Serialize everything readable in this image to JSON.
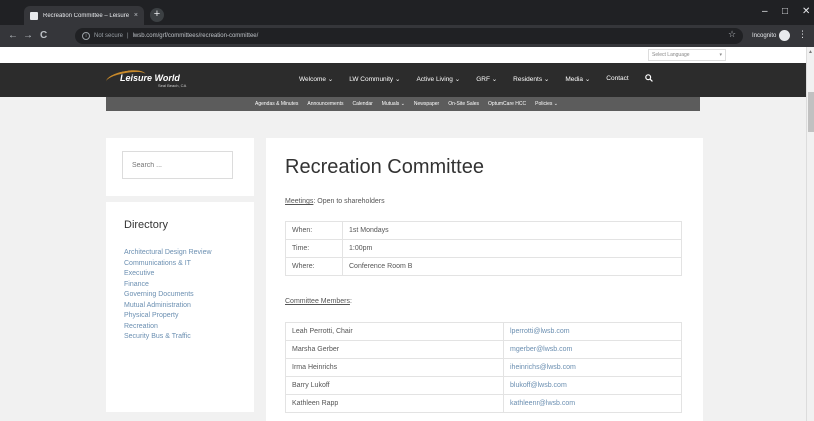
{
  "browser": {
    "tab_title": "Recreation Committee – Leisure",
    "tab_close": "×",
    "new_tab": "+",
    "window_controls": {
      "minimize": "–",
      "maximize": "□",
      "close": "✕"
    },
    "nav": {
      "back": "←",
      "forward": "→",
      "reload": "C"
    },
    "security_label": "Not secure",
    "separator": "|",
    "url": "lwsb.com/grf/committees/recreation-committee/",
    "bookmark_star": "☆",
    "incognito_label": "Incognito",
    "menu": "⋮"
  },
  "site": {
    "language_select": {
      "label": "Select Language",
      "arrow": "▾"
    },
    "logo": {
      "name": "Leisure World",
      "sub": "Seal Beach, CA"
    },
    "main_nav": [
      "Welcome ⌄",
      "LW Community ⌄",
      "Active Living ⌄",
      "GRF ⌄",
      "Residents ⌄",
      "Media ⌄",
      "Contact"
    ],
    "search_icon": "🔍",
    "sub_nav": [
      "Agendas & Minutes",
      "Announcements",
      "Calendar",
      "Mutuals ⌄",
      "Newspaper",
      "On-Site Sales",
      "OptumCare HCC",
      "Policies ⌄"
    ]
  },
  "sidebar": {
    "search_placeholder": "Search ...",
    "directory_title": "Directory",
    "directory_items": [
      "Architectural Design Review",
      "Communications & IT",
      "Executive",
      "Finance",
      "Governing Documents",
      "Mutual Administration",
      "Physical Property",
      "Recreation",
      "Security Bus & Traffic"
    ]
  },
  "content": {
    "title": "Recreation Committee",
    "meetings_label": "Meetings",
    "meetings_text": ": Open to shareholders",
    "meeting_rows": [
      {
        "label": "When:",
        "value": "1st Mondays"
      },
      {
        "label": "Time:",
        "value": "1:00pm"
      },
      {
        "label": "Where:",
        "value": "Conference Room B"
      }
    ],
    "members_label": "Committee Members",
    "members_colon": ":",
    "members": [
      {
        "name": "Leah Perrotti, Chair",
        "email": "lperrotti@lwsb.com"
      },
      {
        "name": "Marsha Gerber",
        "email": "mgerber@lwsb.com"
      },
      {
        "name": "Irma Heinrichs",
        "email": "iheinrichs@lwsb.com"
      },
      {
        "name": "Barry Lukoff",
        "email": "blukoff@lwsb.com"
      },
      {
        "name": "Kathleen Rapp",
        "email": "kathleenr@lwsb.com"
      }
    ]
  }
}
